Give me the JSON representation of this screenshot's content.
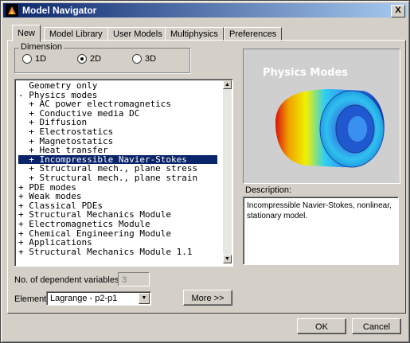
{
  "window": {
    "title": "Model Navigator",
    "close_symbol": "X"
  },
  "tabs": [
    "New",
    "Model Library",
    "User Models",
    "Multiphysics",
    "Preferences"
  ],
  "dimension": {
    "label": "Dimension",
    "options": [
      "1D",
      "2D",
      "3D"
    ],
    "selected": "2D"
  },
  "tree": {
    "items": [
      "  Geometry only",
      "- Physics modes",
      "  + AC power electromagnetics",
      "  + Conductive media DC",
      "  + Diffusion",
      "  + Electrostatics",
      "  + Magnetostatics",
      "  + Heat transfer",
      "  + Incompressible Navier-Stokes",
      "  + Structural mech., plane stress",
      "  + Structural mech., plane strain",
      "+ PDE modes",
      "+ Weak modes",
      "+ Classical PDEs",
      "+ Structural Mechanics Module",
      "+ Electromagnetics Module",
      "+ Chemical Engineering Module",
      "+ Applications",
      "+ Structural Mechanics Module 1.1"
    ],
    "selected_index": 8
  },
  "preview": {
    "title": "Physics Modes"
  },
  "description": {
    "label": "Description:",
    "text": "Incompressible Navier-Stokes, nonlinear, stationary model."
  },
  "dependent_vars": {
    "label": "No. of dependent variables:",
    "value": "3"
  },
  "element": {
    "label": "Element:",
    "value": "Lagrange - p2-p1"
  },
  "buttons": {
    "more": "More >>",
    "ok": "OK",
    "cancel": "Cancel"
  }
}
